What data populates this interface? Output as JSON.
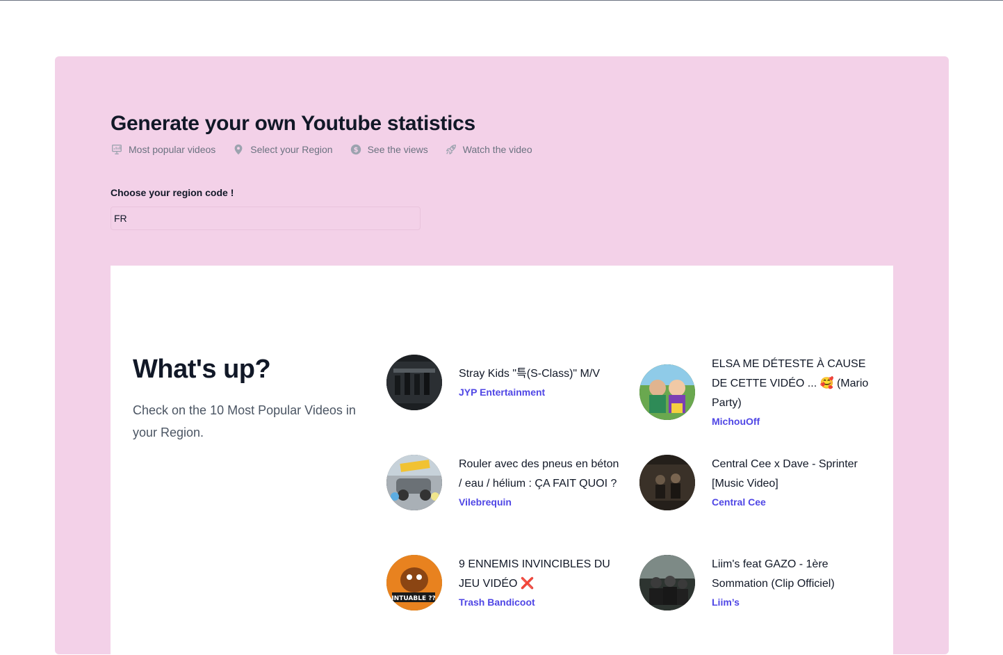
{
  "header": {
    "title": "Generate your own Youtube statistics",
    "features": [
      {
        "icon": "presentation-chart-icon",
        "label": "Most popular videos"
      },
      {
        "icon": "location-pin-icon",
        "label": "Select your Region"
      },
      {
        "icon": "dollar-coin-icon",
        "label": "See the views"
      },
      {
        "icon": "rocket-icon",
        "label": "Watch the video"
      }
    ]
  },
  "region": {
    "label": "Choose your region code !",
    "value": "FR"
  },
  "section": {
    "title": "What's up?",
    "subtitle": "Check on the 10 Most Popular Videos in your Region."
  },
  "videos": [
    {
      "title": "Stray Kids \"특(S-Class)\" M/V",
      "channel": "JYP Entertainment",
      "thumb_color": "#2b2f33"
    },
    {
      "title": "ELSA ME DÉTESTE À CAUSE DE CETTE VIDÉO ... 🥰 (Mario Party)",
      "channel": "MichouOff",
      "thumb_color": "#6aa84f"
    },
    {
      "title": "Rouler avec des pneus en béton / eau / hélium : ÇA FAIT QUOI ?",
      "channel": "Vilebrequin",
      "thumb_color": "#8a8f96"
    },
    {
      "title": "Central Cee x Dave - Sprinter [Music Video]",
      "channel": "Central Cee",
      "thumb_color": "#3a3128"
    },
    {
      "title": "9 ENNEMIS INVINCIBLES DU JEU VIDÉO ❌",
      "channel": "Trash Bandicoot",
      "thumb_color": "#e8821f"
    },
    {
      "title": "Liim's feat GAZO - 1ère Sommation (Clip Officiel)",
      "channel": "Liim’s",
      "thumb_color": "#4d5650"
    }
  ]
}
